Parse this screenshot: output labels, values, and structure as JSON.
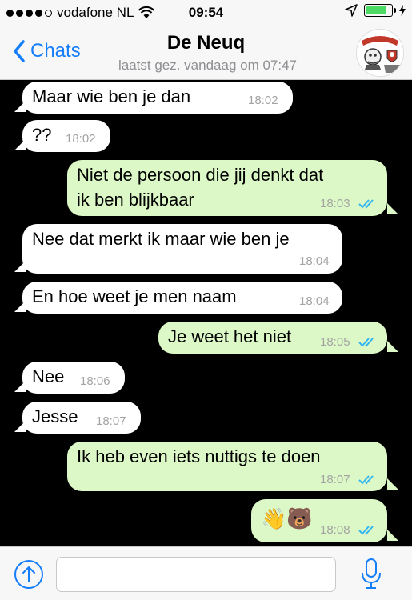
{
  "status_bar": {
    "carrier": "vodafone NL",
    "time": "09:54",
    "battery_level": 0.85
  },
  "nav": {
    "back_label": "Chats",
    "title": "De Neuq",
    "subtitle": "laatst gez. vandaag om 07:47"
  },
  "messages": [
    {
      "direction": "in",
      "text": "Maar wie ben je dan",
      "time": "18:02"
    },
    {
      "direction": "in",
      "text": "??",
      "time": "18:02"
    },
    {
      "direction": "out",
      "text": "Niet de persoon die jij denkt dat\nik ben blijkbaar",
      "time": "18:03",
      "read": true
    },
    {
      "direction": "in",
      "text": "Nee dat merkt ik maar wie ben je",
      "time": "18:04"
    },
    {
      "direction": "in",
      "text": "En hoe weet je men naam",
      "time": "18:04"
    },
    {
      "direction": "out",
      "text": "Je weet het niet",
      "time": "18:05",
      "read": true
    },
    {
      "direction": "in",
      "text": "Nee",
      "time": "18:06"
    },
    {
      "direction": "in",
      "text": "Jesse",
      "time": "18:07"
    },
    {
      "direction": "out",
      "text": "Ik heb even iets nuttigs te doen",
      "time": "18:07",
      "read": true
    },
    {
      "direction": "out",
      "text": "👋🐻",
      "time": "18:08",
      "read": true
    }
  ],
  "input": {
    "placeholder": ""
  },
  "icons": {
    "back": "chevron-left-icon",
    "upload": "upload-icon",
    "mic": "microphone-icon",
    "read_receipt": "double-check-icon"
  },
  "colors": {
    "accent": "#157efb",
    "outgoing_bubble": "#dcf8c6",
    "incoming_bubble": "#ffffff",
    "read_check": "#34b7f1"
  }
}
